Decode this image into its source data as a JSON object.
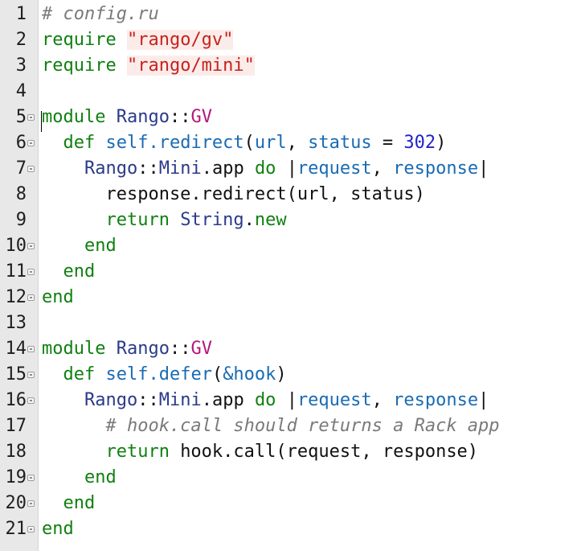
{
  "editor": {
    "lines": [
      {
        "n": "1",
        "fold": false,
        "tokens": [
          {
            "t": "# config.ru",
            "c": "comment"
          }
        ]
      },
      {
        "n": "2",
        "fold": false,
        "tokens": [
          {
            "t": "require ",
            "c": "keyword"
          },
          {
            "t": "\"rango/gv\"",
            "c": "string"
          }
        ]
      },
      {
        "n": "3",
        "fold": false,
        "tokens": [
          {
            "t": "require ",
            "c": "keyword"
          },
          {
            "t": "\"rango/mini\"",
            "c": "string"
          }
        ]
      },
      {
        "n": "4",
        "fold": false,
        "tokens": []
      },
      {
        "n": "5",
        "fold": true,
        "tokens": [
          {
            "t": "module ",
            "c": "keyword"
          },
          {
            "t": "Rango",
            "c": "const"
          },
          {
            "t": "::",
            "c": "plain"
          },
          {
            "t": "GV",
            "c": "sym"
          }
        ]
      },
      {
        "n": "6",
        "fold": true,
        "tokens": [
          {
            "t": "  def ",
            "c": "keyword"
          },
          {
            "t": "self.redirect",
            "c": "method"
          },
          {
            "t": "(",
            "c": "plain"
          },
          {
            "t": "url",
            "c": "var"
          },
          {
            "t": ", ",
            "c": "plain"
          },
          {
            "t": "status",
            "c": "var"
          },
          {
            "t": " = ",
            "c": "plain"
          },
          {
            "t": "302",
            "c": "num"
          },
          {
            "t": ")",
            "c": "plain"
          }
        ]
      },
      {
        "n": "7",
        "fold": true,
        "tokens": [
          {
            "t": "    ",
            "c": "plain"
          },
          {
            "t": "Rango",
            "c": "const"
          },
          {
            "t": "::",
            "c": "plain"
          },
          {
            "t": "Mini",
            "c": "const"
          },
          {
            "t": ".app ",
            "c": "plain"
          },
          {
            "t": "do ",
            "c": "keyword"
          },
          {
            "t": "|",
            "c": "plain"
          },
          {
            "t": "request",
            "c": "var"
          },
          {
            "t": ", ",
            "c": "plain"
          },
          {
            "t": "response",
            "c": "var"
          },
          {
            "t": "|",
            "c": "plain"
          }
        ]
      },
      {
        "n": "8",
        "fold": false,
        "tokens": [
          {
            "t": "      response.redirect(url, status)",
            "c": "plain"
          }
        ]
      },
      {
        "n": "9",
        "fold": false,
        "tokens": [
          {
            "t": "      return ",
            "c": "keyword"
          },
          {
            "t": "String",
            "c": "const"
          },
          {
            "t": ".",
            "c": "plain"
          },
          {
            "t": "new",
            "c": "keyword"
          }
        ]
      },
      {
        "n": "10",
        "fold": true,
        "tokens": [
          {
            "t": "    end",
            "c": "keyword"
          }
        ]
      },
      {
        "n": "11",
        "fold": true,
        "tokens": [
          {
            "t": "  end",
            "c": "keyword"
          }
        ]
      },
      {
        "n": "12",
        "fold": true,
        "tokens": [
          {
            "t": "end",
            "c": "keyword"
          }
        ]
      },
      {
        "n": "13",
        "fold": false,
        "tokens": []
      },
      {
        "n": "14",
        "fold": true,
        "tokens": [
          {
            "t": "module ",
            "c": "keyword"
          },
          {
            "t": "Rango",
            "c": "const"
          },
          {
            "t": "::",
            "c": "plain"
          },
          {
            "t": "GV",
            "c": "sym"
          }
        ]
      },
      {
        "n": "15",
        "fold": true,
        "tokens": [
          {
            "t": "  def ",
            "c": "keyword"
          },
          {
            "t": "self.defer",
            "c": "method"
          },
          {
            "t": "(",
            "c": "plain"
          },
          {
            "t": "&hook",
            "c": "var"
          },
          {
            "t": ")",
            "c": "plain"
          }
        ]
      },
      {
        "n": "16",
        "fold": true,
        "tokens": [
          {
            "t": "    ",
            "c": "plain"
          },
          {
            "t": "Rango",
            "c": "const"
          },
          {
            "t": "::",
            "c": "plain"
          },
          {
            "t": "Mini",
            "c": "const"
          },
          {
            "t": ".app ",
            "c": "plain"
          },
          {
            "t": "do ",
            "c": "keyword"
          },
          {
            "t": "|",
            "c": "plain"
          },
          {
            "t": "request",
            "c": "var"
          },
          {
            "t": ", ",
            "c": "plain"
          },
          {
            "t": "response",
            "c": "var"
          },
          {
            "t": "|",
            "c": "plain"
          }
        ]
      },
      {
        "n": "17",
        "fold": false,
        "tokens": [
          {
            "t": "      # hook.call should returns a Rack app",
            "c": "comment"
          }
        ]
      },
      {
        "n": "18",
        "fold": false,
        "tokens": [
          {
            "t": "      return ",
            "c": "keyword"
          },
          {
            "t": "hook.call(request, response)",
            "c": "plain"
          }
        ]
      },
      {
        "n": "19",
        "fold": true,
        "tokens": [
          {
            "t": "    end",
            "c": "keyword"
          }
        ]
      },
      {
        "n": "20",
        "fold": true,
        "tokens": [
          {
            "t": "  end",
            "c": "keyword"
          }
        ]
      },
      {
        "n": "21",
        "fold": true,
        "tokens": [
          {
            "t": "end",
            "c": "keyword"
          }
        ]
      }
    ]
  }
}
